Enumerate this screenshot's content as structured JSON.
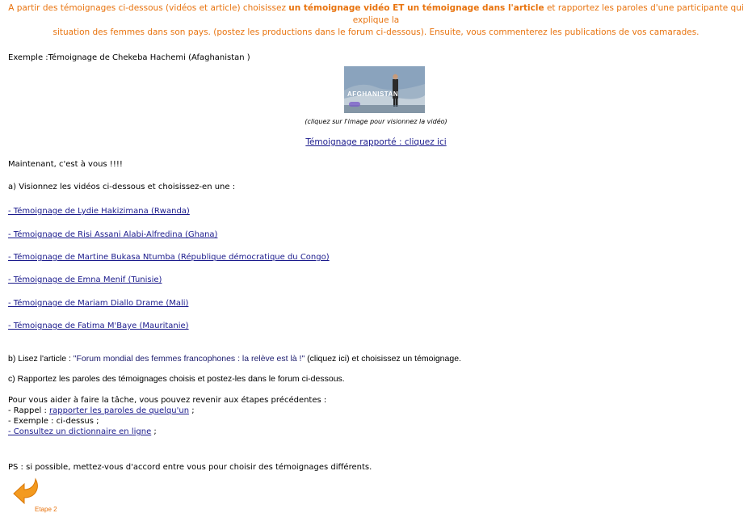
{
  "intro": {
    "part1": "A partir des témoignages ci-dessous (vidéos et article) choisissez ",
    "bold": "un témoignage vidéo ET un témoignage dans l'article",
    "part2": " et rapportez les paroles d'une participante qui explique la",
    "line2": "situation des femmes dans son pays. (postez les productions dans le forum ci-dessous). Ensuite, vous commenterez les publications de vos camarades."
  },
  "example": {
    "label": "Exemple :Témoignage de Chekeba Hachemi (Afaghanistan )",
    "thumb_text": "AFGHANISTAN",
    "caption": "(cliquez sur l'image pour visionnez la vidéo)",
    "link": "Témoignage rapporté : cliquez ici"
  },
  "now": "Maintenant, c'est à vous !!!!",
  "step_a": "a) Visionnez les vidéos ci-dessous et choisissez-en une :",
  "videos": [
    "- Témoignage de Lydie Hakizimana (Rwanda)",
    "- Témoignage de Risi Assani Alabi-Alfredina (Ghana)",
    "- Témoignage de Martine Bukasa Ntumba (République démocratique du Congo)",
    "- Témoignage de Emna Menif (Tunisie)",
    "- Témoignage de Mariam Diallo Drame (Mali)",
    "- Témoignage de Fatima M'Baye (Mauritanie)"
  ],
  "step_b": {
    "prefix": "b) Lisez l'article : ",
    "article": "\"Forum mondial des femmes francophones : la relève est là !\"",
    "suffix": " (cliquez ici) et choisissez un témoignage."
  },
  "step_c": "c) Rapportez les paroles des témoignages choisis et postez-les dans le forum ci-dessous.",
  "help": {
    "title": "Pour vous aider à faire la tâche, vous pouvez revenir aux étapes précédentes :",
    "rappel_prefix": "- Rappel : ",
    "rappel_link": "rapporter les paroles de quelqu'un",
    "rappel_suffix": " ;",
    "exemple": "- Exemple : ci-dessus ;",
    "dict_link": "- Consultez un dictionnaire en ligne",
    "dict_suffix": " ;"
  },
  "ps": "PS : si possible, mettez-vous d'accord entre vous pour choisir des témoignages différents.",
  "nav": {
    "etape": "Etape 2",
    "arrow_icon": "back-arrow-icon",
    "accent": "#e8730e"
  }
}
